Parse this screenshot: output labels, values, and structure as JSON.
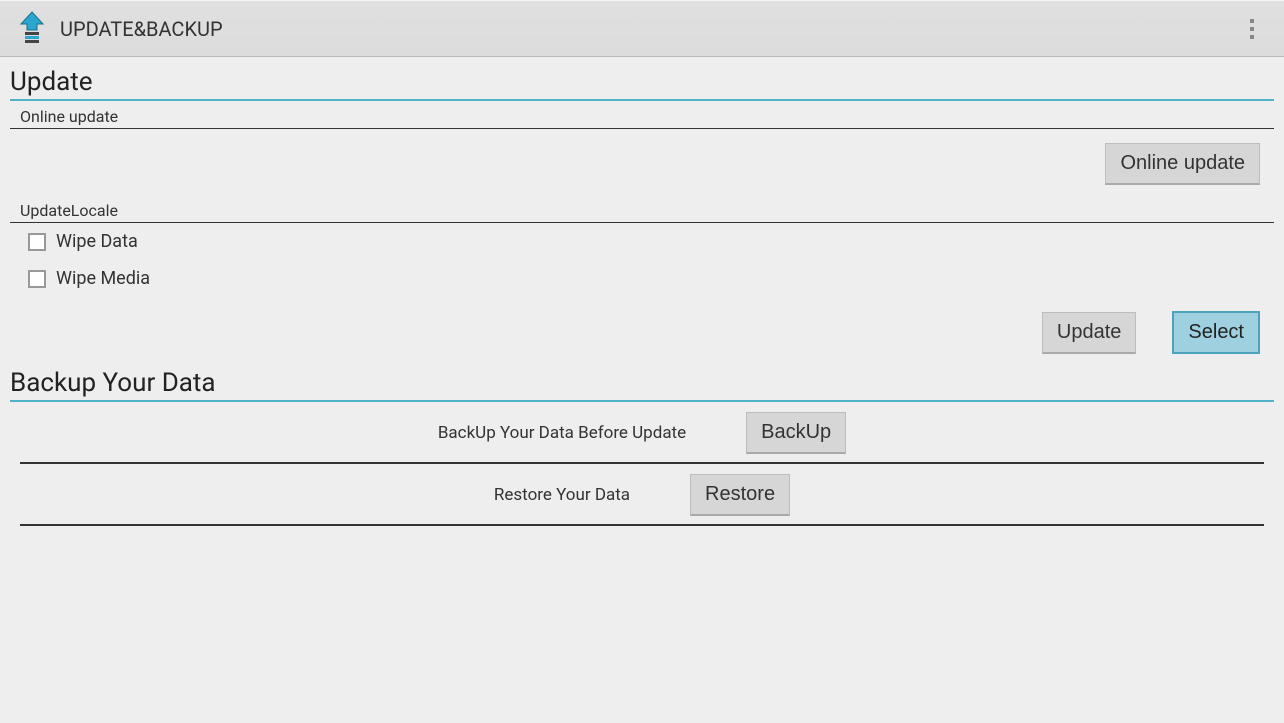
{
  "header": {
    "title": "UPDATE&BACKUP"
  },
  "update": {
    "section_title": "Update",
    "online_update_label": "Online update",
    "online_update_button": "Online update",
    "update_locale_label": "UpdateLocale",
    "wipe_data_label": "Wipe Data",
    "wipe_media_label": "Wipe Media",
    "update_button": "Update",
    "select_button": "Select"
  },
  "backup": {
    "section_title": "Backup Your Data",
    "backup_label": "BackUp Your Data Before Update",
    "backup_button": "BackUp",
    "restore_label": "Restore Your Data",
    "restore_button": "Restore"
  },
  "colors": {
    "accent": "#4fb2c9"
  }
}
